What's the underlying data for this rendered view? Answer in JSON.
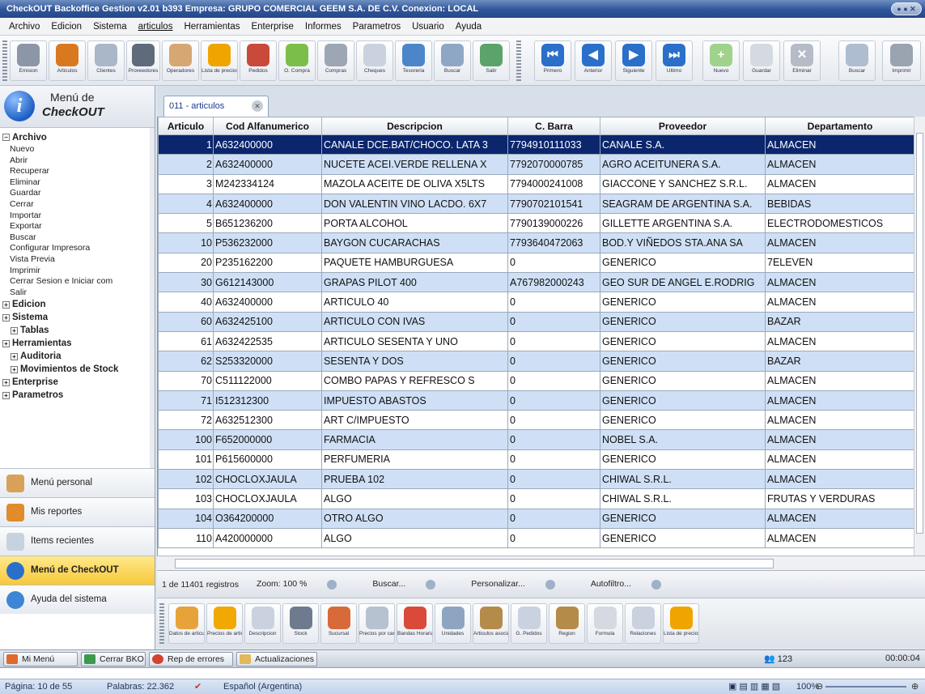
{
  "window": {
    "title": "CheckOUT Backoffice Gestion v2.01 b393 Empresa: GRUPO COMERCIAL GEEM S.A. DE C.V. Conexion: LOCAL"
  },
  "menu": [
    "Archivo",
    "Edicion",
    "Sistema",
    "articulos",
    "Herramientas",
    "Enterprise",
    "Informes",
    "Parametros",
    "Usuario",
    "Ayuda"
  ],
  "toolbar": {
    "left": [
      "Emision",
      "Articulos",
      "Clientes",
      "Proveedores",
      "Operadores",
      "Lista de precios",
      "Pedidos",
      "O. Compra",
      "Compras",
      "Cheques",
      "Tesoreria",
      "Buscar",
      "Salir"
    ],
    "right": [
      "Primero",
      "Anterior",
      "Siguiente",
      "Ultimo",
      "Nuevo",
      "Guardar",
      "Eliminar",
      "Buscar",
      "Imprimir"
    ]
  },
  "left_panel": {
    "header_line1": "Menú de",
    "header_line2": "CheckOUT",
    "tree": [
      {
        "label": "Archivo",
        "kind": "sec",
        "sign": "−"
      },
      {
        "label": "Nuevo",
        "kind": "leaf"
      },
      {
        "label": "Abrir",
        "kind": "leaf"
      },
      {
        "label": "Recuperar",
        "kind": "leaf"
      },
      {
        "label": "Eliminar",
        "kind": "leaf"
      },
      {
        "label": "Guardar",
        "kind": "leaf"
      },
      {
        "label": "Cerrar",
        "kind": "leaf"
      },
      {
        "label": "Importar",
        "kind": "leaf"
      },
      {
        "label": "Exportar",
        "kind": "leaf"
      },
      {
        "label": "Buscar",
        "kind": "leaf"
      },
      {
        "label": "Configurar Impresora",
        "kind": "leaf"
      },
      {
        "label": "Vista Previa",
        "kind": "leaf"
      },
      {
        "label": "Imprimir",
        "kind": "leaf"
      },
      {
        "label": "Cerrar Sesion e Iniciar com",
        "kind": "leaf"
      },
      {
        "label": "Salir",
        "kind": "leaf"
      },
      {
        "label": "Edicion",
        "kind": "sec",
        "sign": "+"
      },
      {
        "label": "Sistema",
        "kind": "sec",
        "sign": "+"
      },
      {
        "label": "Tablas",
        "kind": "secsub",
        "sign": "+"
      },
      {
        "label": "Herramientas",
        "kind": "sec",
        "sign": "+"
      },
      {
        "label": "Auditoria",
        "kind": "secsub",
        "sign": "+"
      },
      {
        "label": "Movimientos de Stock",
        "kind": "secsub",
        "sign": "+"
      },
      {
        "label": "Enterprise",
        "kind": "sec",
        "sign": "+"
      },
      {
        "label": "Parametros",
        "kind": "sec",
        "sign": "+"
      }
    ],
    "buttons": [
      "Menú personal",
      "Mis reportes",
      "Items recientes",
      "Menú de CheckOUT",
      "Ayuda del sistema"
    ]
  },
  "doc_tab": "011 - articulos",
  "table": {
    "headers": [
      "Articulo",
      "Cod Alfanumerico",
      "Descripcion",
      "C. Barra",
      "Proveedor",
      "Departamento"
    ],
    "rows": [
      [
        "1",
        "A632400000",
        "CANALE DCE.BAT/CHOCO. LATA 3",
        "7794910111033",
        "CANALE S.A.",
        "ALMACEN"
      ],
      [
        "2",
        "A632400000",
        "NUCETE ACEI.VERDE RELLENA X",
        "7792070000785",
        "AGRO ACEITUNERA S.A.",
        "ALMACEN"
      ],
      [
        "3",
        "M242334124",
        "MAZOLA ACEITE DE OLIVA  X5LTS",
        "7794000241008",
        "GIACCONE Y SANCHEZ S.R.L.",
        "ALMACEN"
      ],
      [
        "4",
        "A632400000",
        "DON VALENTIN VINO LACDO. 6X7",
        "7790702101541",
        "SEAGRAM DE ARGENTINA S.A.",
        "BEBIDAS"
      ],
      [
        "5",
        "B651236200",
        "PORTA ALCOHOL",
        "7790139000226",
        "GILLETTE ARGENTINA S.A.",
        "ELECTRODOMESTICOS"
      ],
      [
        "10",
        "P536232000",
        "BAYGON CUCARACHAS",
        "7793640472063",
        "BOD.Y VIÑEDOS STA.ANA SA",
        "ALMACEN"
      ],
      [
        "20",
        "P235162200",
        "PAQUETE HAMBURGUESA",
        "0",
        "GENERICO",
        "7ELEVEN"
      ],
      [
        "30",
        "G612143000",
        "GRAPAS PILOT 400",
        "A767982000243",
        "GEO SUR DE ANGEL E.RODRIG",
        "ALMACEN"
      ],
      [
        "40",
        "A632400000",
        "ARTICULO 40",
        "0",
        "GENERICO",
        "ALMACEN"
      ],
      [
        "60",
        "A632425100",
        "ARTICULO CON IVAS",
        "0",
        "GENERICO",
        "BAZAR"
      ],
      [
        "61",
        "A632422535",
        "ARTICULO SESENTA Y UNO",
        "0",
        "GENERICO",
        "ALMACEN"
      ],
      [
        "62",
        "S253320000",
        "SESENTA Y DOS",
        "0",
        "GENERICO",
        "BAZAR"
      ],
      [
        "70",
        "C511122000",
        "COMBO PAPAS Y REFRESCO S",
        "0",
        "GENERICO",
        "ALMACEN"
      ],
      [
        "71",
        "I512312300",
        "IMPUESTO ABASTOS",
        "0",
        "GENERICO",
        "ALMACEN"
      ],
      [
        "72",
        "A632512300",
        "ART C/IMPUESTO",
        "0",
        "GENERICO",
        "ALMACEN"
      ],
      [
        "100",
        "F652000000",
        "FARMACIA",
        "0",
        "NOBEL S.A.",
        "ALMACEN"
      ],
      [
        "101",
        "P615600000",
        "PERFUMERIA",
        "0",
        "GENERICO",
        "ALMACEN"
      ],
      [
        "102",
        "CHOCLOXJAULA",
        "PRUEBA 102",
        "0",
        "CHIWAL S.R.L.",
        "ALMACEN"
      ],
      [
        "103",
        "CHOCLOXJAULA",
        "ALGO",
        "0",
        "CHIWAL S.R.L.",
        "FRUTAS Y VERDURAS"
      ],
      [
        "104",
        "O364200000",
        "OTRO ALGO",
        "0",
        "GENERICO",
        "ALMACEN"
      ],
      [
        "110",
        "A420000000",
        "ALGO",
        "0",
        "GENERICO",
        "ALMACEN"
      ]
    ]
  },
  "grid_status": {
    "records": "1 de 11401 registros",
    "zoom": "Zoom: 100 %",
    "search": "Buscar...",
    "customize": "Personalizar...",
    "autofilter": "Autofiltro..."
  },
  "bottom_toolbar": [
    "Datos de articulos",
    "Precios de articulos",
    "Descripcion",
    "Stock",
    "Sucursal",
    "Precios por cantidad",
    "Bandas Horarias",
    "Unidades",
    "Articulos asociados",
    "G. Pedidos",
    "Region",
    "Formula",
    "Relaciones",
    "Lista de precios"
  ],
  "taskbar": {
    "items": [
      "Mi Menú",
      "Cerrar BKO",
      "Rep de errores",
      "Actualizaciones"
    ],
    "count": "123",
    "time": "00:00:04"
  },
  "word_status": {
    "page": "Página: 10 de 55",
    "words": "Palabras: 22.362",
    "language": "Español (Argentina)",
    "zoom": "100%"
  },
  "colors": {
    "title_bar": "#2f559a",
    "selected_row": "#0b266d",
    "alt_row": "#cfe0f6",
    "active_menu_button": "#f7c83c"
  }
}
